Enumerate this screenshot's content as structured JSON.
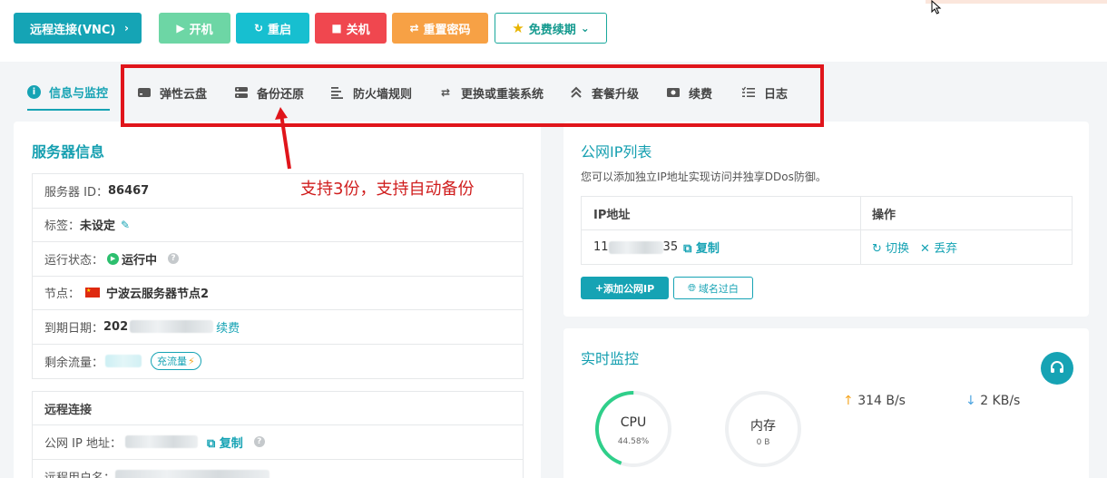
{
  "toolbar": {
    "vnc": "远程连接(VNC)",
    "power_on": "开机",
    "restart": "重启",
    "shutdown": "关机",
    "reset_password": "重置密码",
    "free_renew": "免费续期"
  },
  "tabs": [
    {
      "label": "信息与监控",
      "icon": "info-icon"
    },
    {
      "label": "弹性云盘",
      "icon": "disk-icon"
    },
    {
      "label": "备份还原",
      "icon": "backup-icon"
    },
    {
      "label": "防火墙规则",
      "icon": "firewall-icon"
    },
    {
      "label": "更换或重装系统",
      "icon": "swap-icon"
    },
    {
      "label": "套餐升级",
      "icon": "upgrade-icon"
    },
    {
      "label": "续费",
      "icon": "renew-icon"
    },
    {
      "label": "日志",
      "icon": "log-icon"
    }
  ],
  "annotation": "支持3份，支持自动备份",
  "server_info": {
    "title": "服务器信息",
    "id_label": "服务器 ID：",
    "id_value": "86467",
    "tag_label": "标签：",
    "tag_value": "未设定",
    "status_label": "运行状态：",
    "status_value": "运行中",
    "node_label": "节点：",
    "node_value": "宁波云服务器节点2",
    "expire_label": "到期日期：",
    "expire_value": "202",
    "renew_link": "续费",
    "traffic_label": "剩余流量：",
    "traffic_button": "充流量",
    "remote_title": "远程连接",
    "public_ip_label": "公网 IP 地址：",
    "copy": "复制",
    "remote_user_label": "远程用户名："
  },
  "public_ip": {
    "title": "公网IP列表",
    "description": "您可以添加独立IP地址实现访问并独享DDos防御。",
    "col_ip": "IP地址",
    "col_action": "操作",
    "ip_prefix": "11",
    "ip_suffix": "35",
    "copy": "复制",
    "switch": "切换",
    "discard": "丢弃",
    "add_button": "添加公网IP",
    "domain_button": "域名过白"
  },
  "monitor": {
    "title": "实时监控",
    "cpu_label": "CPU",
    "cpu_value": "44.58%",
    "cpu_fraction": 0.4458,
    "mem_label": "内存",
    "mem_value": "0 B",
    "upload": "314 B/s",
    "download": "2 KB/s"
  },
  "colors": {
    "accent": "#16a3b4",
    "annotation": "#e0151b"
  }
}
